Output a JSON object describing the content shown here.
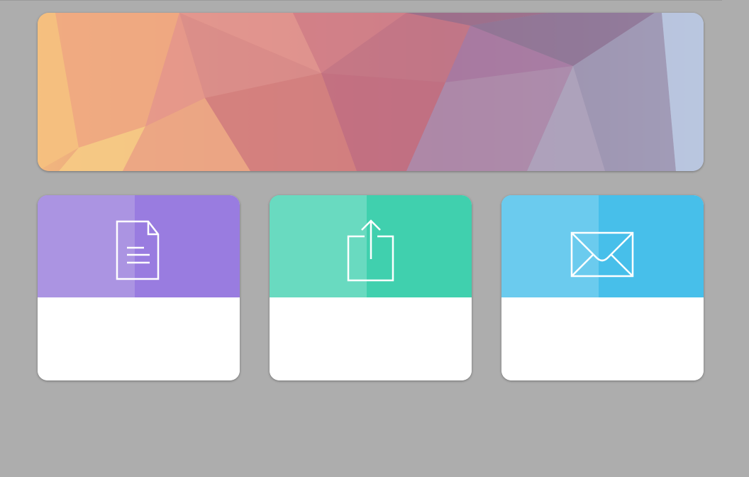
{
  "colors": {
    "background": "#adadad",
    "card_document_top": "#997ce0",
    "card_document_top_light": "#ab94e2",
    "card_share_top": "#40d0ae",
    "card_share_top_light": "#69dac0",
    "card_mail_top": "#47bfea",
    "card_mail_top_light": "#6bcbee",
    "card_bottom": "#ffffff",
    "icon_stroke": "#ffffff"
  },
  "banner": {
    "image": "low-poly-gradient-banner"
  },
  "cards": [
    {
      "icon": "document-icon",
      "label": ""
    },
    {
      "icon": "share-icon",
      "label": ""
    },
    {
      "icon": "mail-icon",
      "label": ""
    }
  ]
}
